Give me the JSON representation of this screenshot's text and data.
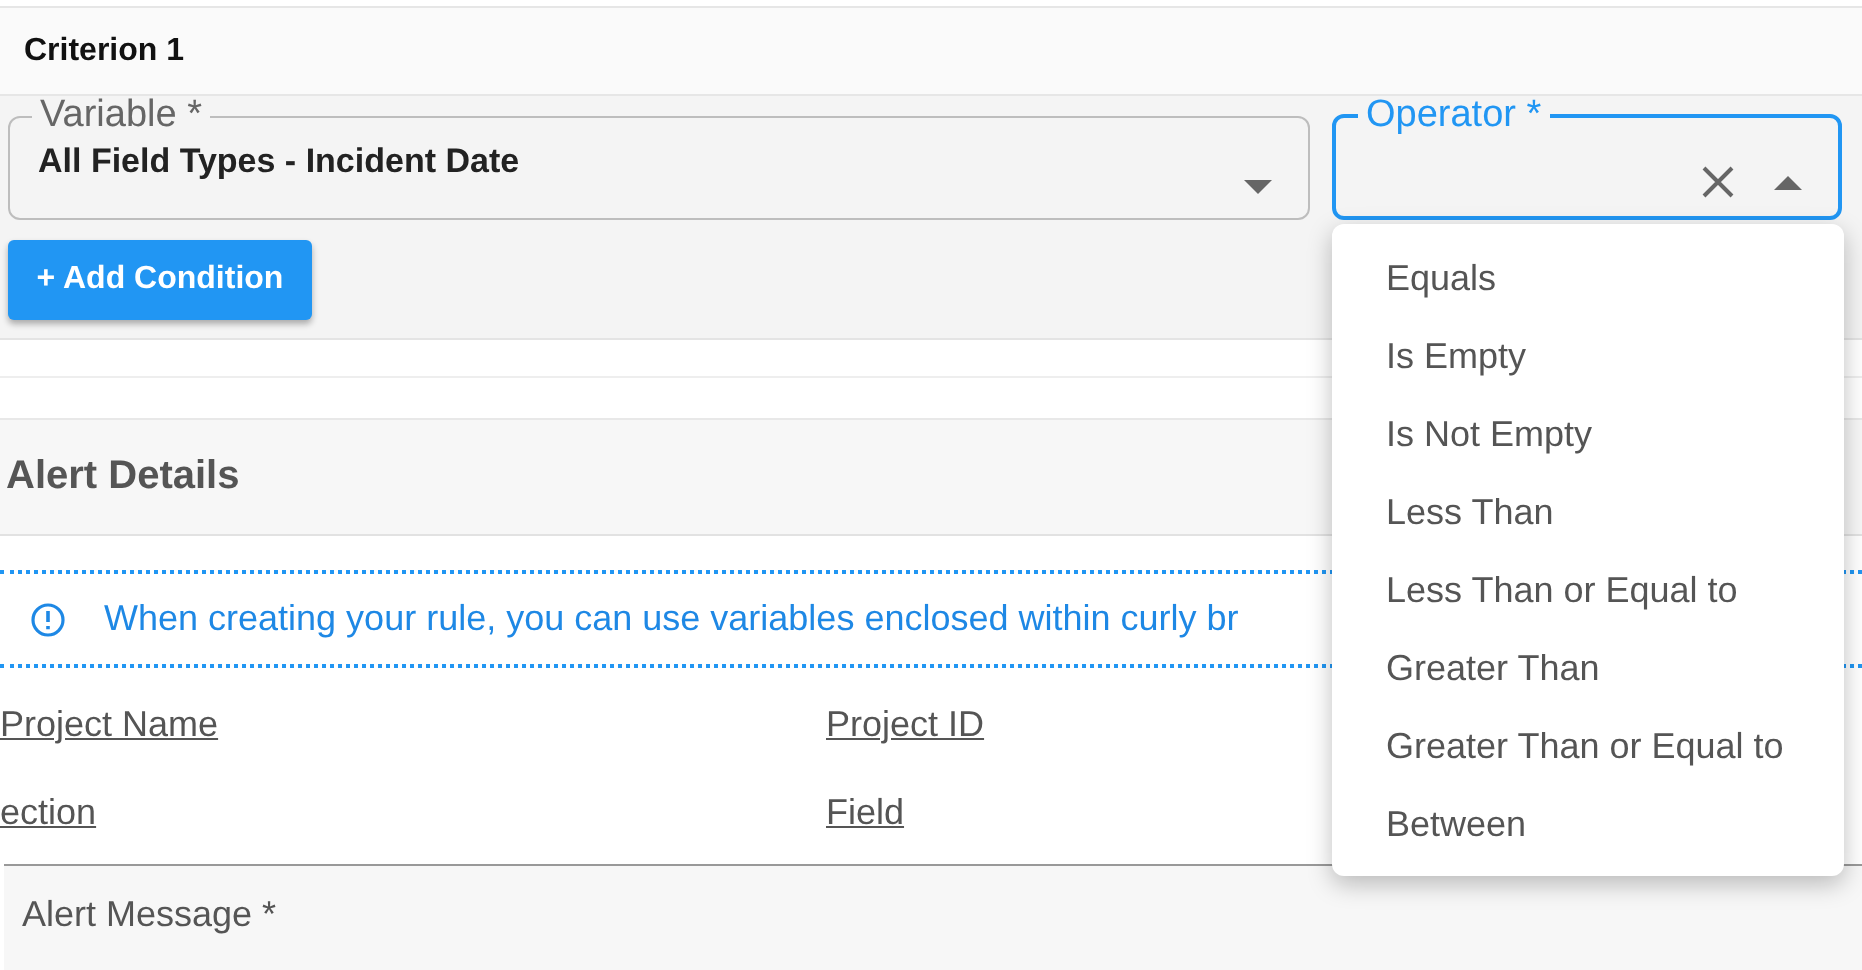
{
  "criterion": {
    "title": "Criterion 1"
  },
  "variable_field": {
    "label": "Variable *",
    "value": "All Field Types - Incident Date"
  },
  "operator_field": {
    "label": "Operator *",
    "focused": true,
    "open": true,
    "options": [
      {
        "label": "Equals"
      },
      {
        "label": "Is Empty"
      },
      {
        "label": "Is Not Empty"
      },
      {
        "label": "Less Than"
      },
      {
        "label": "Less Than or Equal to"
      },
      {
        "label": "Greater Than"
      },
      {
        "label": "Greater Than or Equal to"
      },
      {
        "label": "Between"
      }
    ]
  },
  "add_condition_button": "+ Add Condition",
  "alert_details": {
    "title": "Alert Details",
    "info": "When creating your rule, you can use variables enclosed within curly br",
    "variables": [
      [
        "Project Name",
        "Project ID"
      ],
      [
        "ection",
        "Field"
      ]
    ],
    "alert_message_label": "Alert Message *"
  }
}
